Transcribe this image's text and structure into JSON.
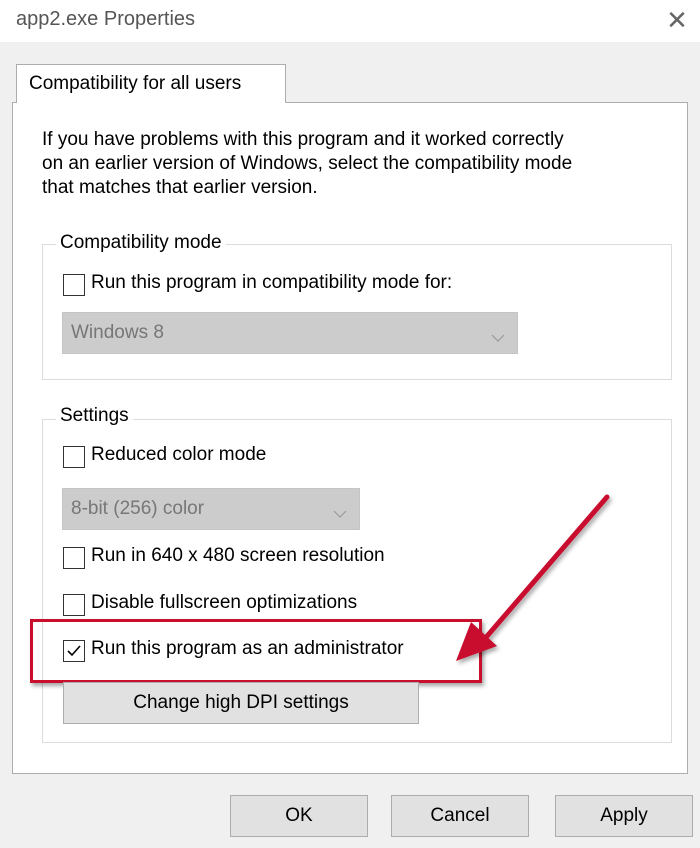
{
  "window": {
    "title": "app2.exe Properties",
    "close_glyph": "✕"
  },
  "tab": {
    "label": "Compatibility for all users"
  },
  "intro": {
    "line1": "If you have problems with this program and it worked correctly",
    "line2": "on an earlier version of Windows, select the compatibility mode",
    "line3": "that matches that earlier version."
  },
  "compat_mode": {
    "legend": "Compatibility mode",
    "checkbox_label": "Run this program in compatibility mode for:",
    "checked": false,
    "selected_os": "Windows 8"
  },
  "settings": {
    "legend": "Settings",
    "reduced_color_label": "Reduced color mode",
    "reduced_color_checked": false,
    "color_selected": "8-bit (256) color",
    "res_640_label": "Run in 640 x 480 screen resolution",
    "res_640_checked": false,
    "fullscreen_label": "Disable fullscreen optimizations",
    "fullscreen_checked": false,
    "admin_label": "Run this program as an administrator",
    "admin_checked": true,
    "dpi_button": "Change high DPI settings"
  },
  "footer": {
    "ok": "OK",
    "cancel": "Cancel",
    "apply": "Apply"
  },
  "colors": {
    "highlight": "#c8102e",
    "arrow": "#c8102e",
    "disabled_select": "#cccccc"
  },
  "icons": {
    "close": "close-icon",
    "chevron": "chevron-down-icon",
    "check": "checkmark-icon",
    "arrow": "red-arrow-annotation"
  }
}
